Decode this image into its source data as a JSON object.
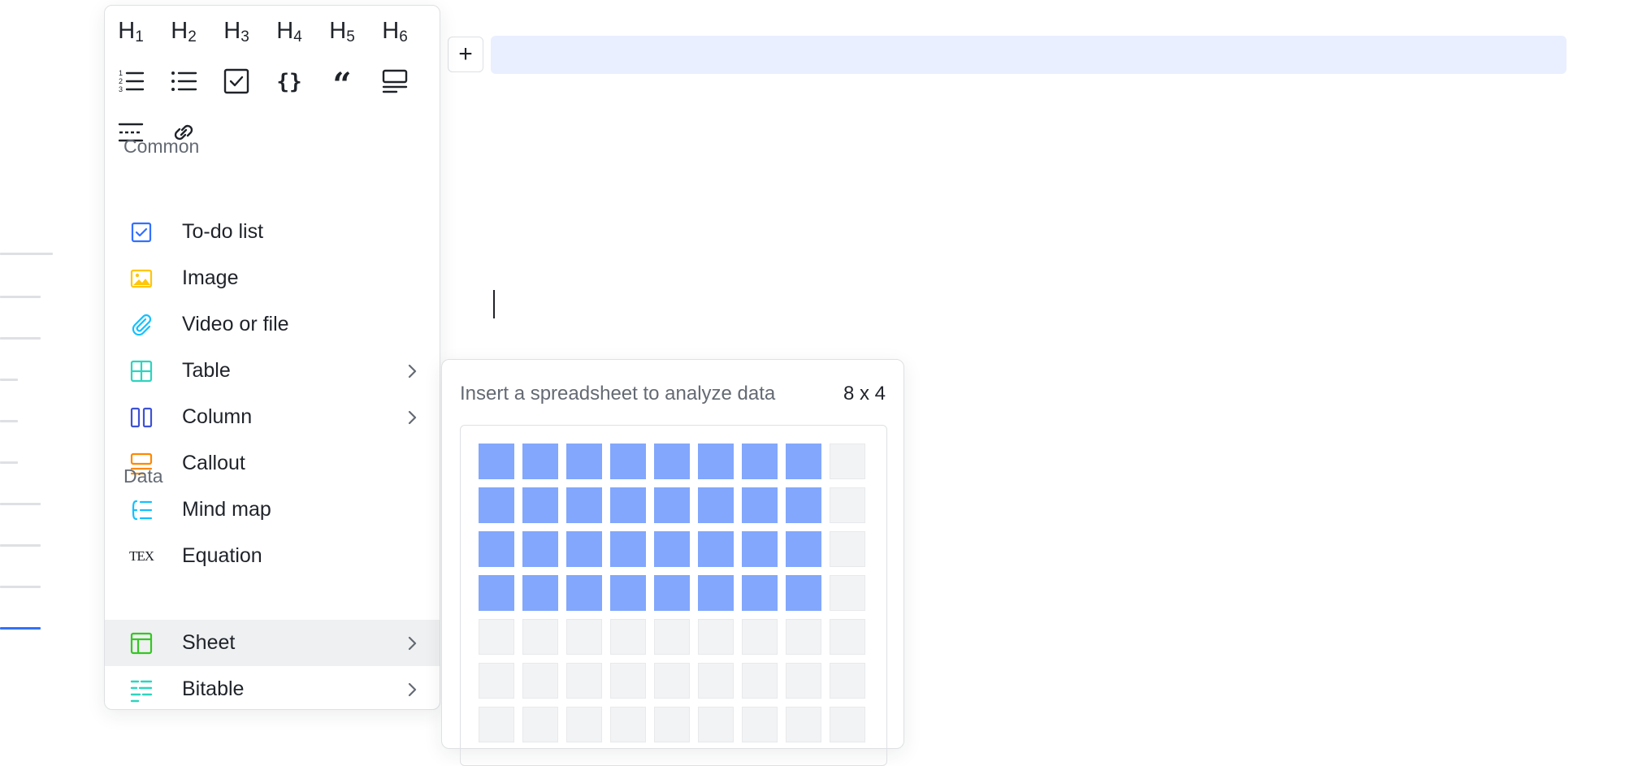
{
  "heading_buttons": [
    {
      "main": "H",
      "sub": "1",
      "name": "heading-1-button"
    },
    {
      "main": "H",
      "sub": "2",
      "name": "heading-2-button"
    },
    {
      "main": "H",
      "sub": "3",
      "name": "heading-3-button"
    },
    {
      "main": "H",
      "sub": "4",
      "name": "heading-4-button"
    },
    {
      "main": "H",
      "sub": "5",
      "name": "heading-5-button"
    },
    {
      "main": "H",
      "sub": "6",
      "name": "heading-6-button"
    }
  ],
  "format_buttons": [
    "ordered-list-icon",
    "bullet-list-icon",
    "checkbox-icon",
    "code-block-icon",
    "quote-icon",
    "callout-block-icon"
  ],
  "misc_buttons": [
    "divider-icon",
    "link-icon"
  ],
  "sections": {
    "common": "Common",
    "data": "Data"
  },
  "common_items": [
    {
      "label": "To-do list",
      "icon": "todo-icon",
      "color": "#3370ff",
      "submenu": false
    },
    {
      "label": "Image",
      "icon": "image-icon",
      "color": "#ffc60a",
      "submenu": false
    },
    {
      "label": "Video or file",
      "icon": "paperclip-icon",
      "color": "#14c0ff",
      "submenu": false
    },
    {
      "label": "Table",
      "icon": "table-icon",
      "color": "#2dd4bf",
      "submenu": true
    },
    {
      "label": "Column",
      "icon": "column-icon",
      "color": "#3d52d5",
      "submenu": true
    },
    {
      "label": "Callout",
      "icon": "callout-icon",
      "color": "#ff8800",
      "submenu": false
    },
    {
      "label": "Mind map",
      "icon": "mindmap-icon",
      "color": "#14c0ff",
      "submenu": false
    },
    {
      "label": "Equation",
      "icon": "tex-icon",
      "icon_text": "TEX",
      "color": "#1f2329",
      "submenu": false
    }
  ],
  "data_items": [
    {
      "label": "Sheet",
      "icon": "sheet-icon",
      "color": "#34c724",
      "submenu": true,
      "hover": true
    },
    {
      "label": "Bitable",
      "icon": "bitable-icon",
      "color": "#2dd4bf",
      "submenu": true,
      "hover": false
    }
  ],
  "sheet_popup": {
    "description": "Insert a spreadsheet to analyze data",
    "size_label": "8 x 4",
    "selected_cols": 8,
    "selected_rows": 4,
    "total_cols": 9,
    "total_rows_visible": 7
  },
  "colors": {
    "accent": "#3370ff",
    "selected_cell": "#82a7fc",
    "hover_row": "#eff0f1",
    "block_highlight": "#e9efff"
  }
}
